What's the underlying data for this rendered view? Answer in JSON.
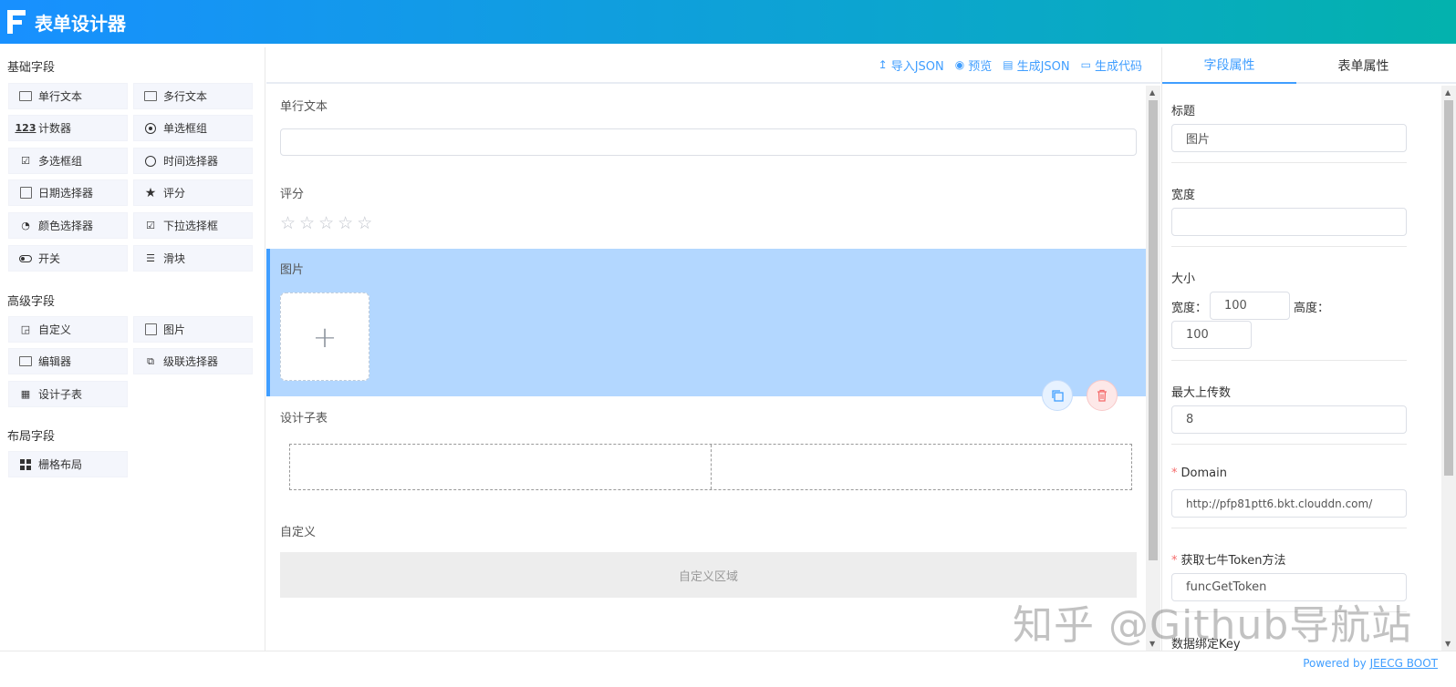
{
  "header": {
    "title": "表单设计器"
  },
  "left": {
    "groups": [
      {
        "title": "基础字段",
        "items": [
          "单行文本",
          "多行文本",
          "计数器",
          "单选框组",
          "多选框组",
          "时间选择器",
          "日期选择器",
          "评分",
          "颜色选择器",
          "下拉选择框",
          "开关",
          "滑块"
        ]
      },
      {
        "title": "高级字段",
        "items": [
          "自定义",
          "图片",
          "编辑器",
          "级联选择器",
          "设计子表"
        ]
      },
      {
        "title": "布局字段",
        "items": [
          "栅格布局"
        ]
      }
    ]
  },
  "toolbar": {
    "import_json": "导入JSON",
    "preview": "预览",
    "gen_json": "生成JSON",
    "gen_code": "生成代码"
  },
  "canvas": {
    "fields": [
      {
        "label": "单行文本"
      },
      {
        "label": "评分",
        "stars": 5
      },
      {
        "label": "图片"
      },
      {
        "label": "设计子表"
      },
      {
        "label": "自定义",
        "area_text": "自定义区域"
      }
    ]
  },
  "right": {
    "tabs": [
      "字段属性",
      "表单属性"
    ],
    "active_tab": "字段属性",
    "props": {
      "title_label": "标题",
      "title_value": "图片",
      "width_label": "宽度",
      "width_value": "",
      "size_label": "大小",
      "size_width_label": "宽度：",
      "size_width_value": "100",
      "size_height_label": "高度：",
      "size_height_value": "100",
      "max_upload_label": "最大上传数",
      "max_upload_value": "8",
      "domain_label": "Domain",
      "domain_value": "http://pfp81ptt6.bkt.clouddn.com/",
      "token_label": "获取七牛Token方法",
      "token_value": "funcGetToken",
      "data_key_label": "数据绑定Key"
    }
  },
  "footer": {
    "powered_prefix": "Powered by ",
    "powered_link": "JEECG BOOT"
  },
  "watermark": "知乎 @Github导航站",
  "colors": {
    "accent": "#409eff",
    "header_start": "#1890ff",
    "header_end": "#03b2ad",
    "selected_bg": "#b3d7ff",
    "danger": "#f56c6c"
  }
}
